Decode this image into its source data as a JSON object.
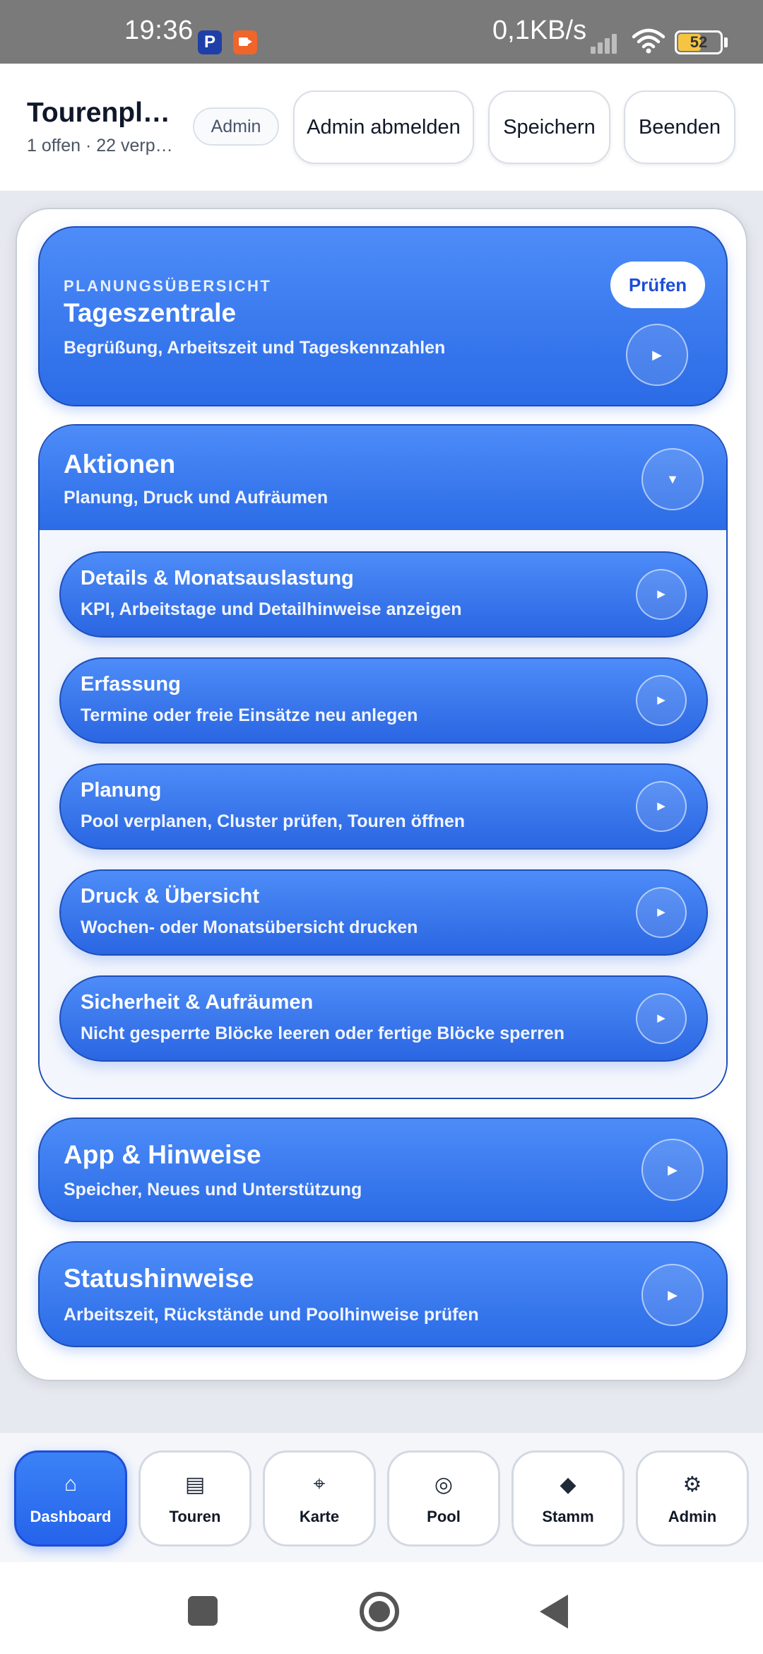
{
  "status_bar": {
    "time": "19:36",
    "network_speed": "0,1KB/s",
    "battery": "52",
    "battery_level": 0.52
  },
  "header": {
    "title": "Tourenpl…",
    "subtitle": "1 offen · 22 verp…",
    "role_badge": "Admin",
    "buttons": {
      "logout_admin": "Admin abmelden",
      "save": "Speichern",
      "quit": "Beenden"
    }
  },
  "overview_card": {
    "eyebrow": "PLANUNGSÜBERSICHT",
    "title": "Tageszentrale",
    "subtitle": "Begrüßung, Arbeitszeit und Tageskennzahlen",
    "check_label": "Prüfen",
    "open_glyph": "▶"
  },
  "actions": {
    "title": "Aktionen",
    "subtitle": "Planung, Druck und Aufräumen",
    "toggle_glyph": "▼",
    "items": [
      {
        "title": "Details & Monatsauslastung",
        "subtitle": "KPI, Arbeitstage und Detailhinweise anzeigen",
        "glyph": "▶"
      },
      {
        "title": "Erfassung",
        "subtitle": "Termine oder freie Einsätze neu anlegen",
        "glyph": "▶"
      },
      {
        "title": "Planung",
        "subtitle": "Pool verplanen, Cluster prüfen, Touren öffnen",
        "glyph": "▶"
      },
      {
        "title": "Druck & Übersicht",
        "subtitle": "Wochen- oder Monatsübersicht drucken",
        "glyph": "▶"
      },
      {
        "title": "Sicherheit & Aufräumen",
        "subtitle": "Nicht gesperrte Blöcke leeren oder fertige Blöcke sperren",
        "glyph": "▶"
      }
    ]
  },
  "app_card": {
    "title": "App & Hinweise",
    "subtitle": "Speicher, Neues und Unterstützung",
    "glyph": "▶"
  },
  "status_card": {
    "title": "Statushinweise",
    "subtitle": "Arbeitszeit, Rückstände und Poolhinweise prüfen",
    "glyph": "▶"
  },
  "bottom_nav": [
    {
      "label": "Dashboard",
      "icon": "home-icon",
      "glyph": "⌂",
      "active": true
    },
    {
      "label": "Touren",
      "icon": "list-icon",
      "glyph": "▤",
      "active": false
    },
    {
      "label": "Karte",
      "icon": "crosshair-icon",
      "glyph": "⌖",
      "active": false
    },
    {
      "label": "Pool",
      "icon": "target-icon",
      "glyph": "◎",
      "active": false
    },
    {
      "label": "Stamm",
      "icon": "diamond-icon",
      "glyph": "◆",
      "active": false
    },
    {
      "label": "Admin",
      "icon": "gear-icon",
      "glyph": "⚙",
      "active": false
    }
  ],
  "colors": {
    "accent": "#2b6be6",
    "accent_light": "#4d8cf8",
    "border_dark": "#1e4fb8"
  }
}
